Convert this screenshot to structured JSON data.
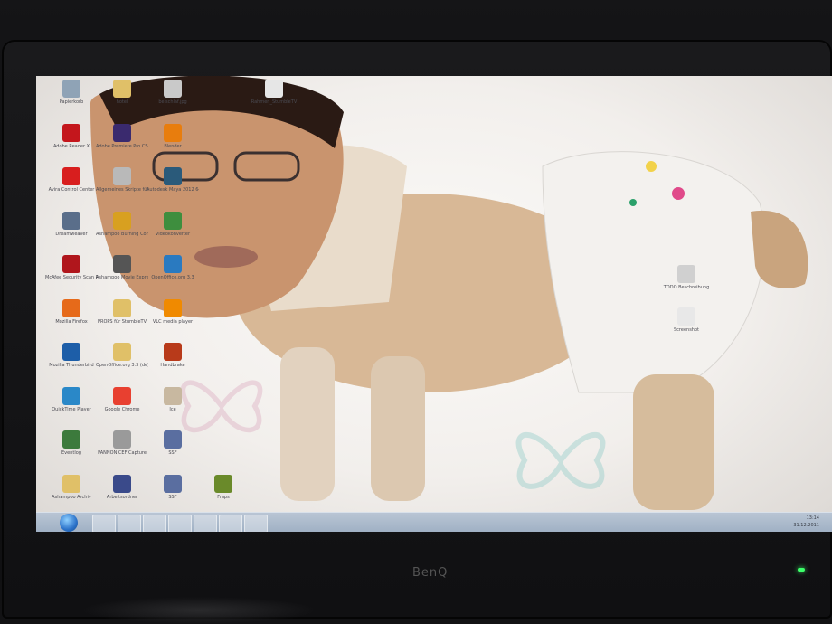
{
  "monitor": {
    "brand": "BenQ"
  },
  "desktop_icons": [
    {
      "label": "Papierkorb",
      "icon": "recycle-bin-icon",
      "color": "#8fa3b6"
    },
    {
      "label": "hotel",
      "icon": "folder-icon",
      "color": "#e0c068"
    },
    {
      "label": "beischlaf.jpg",
      "icon": "image-file-icon",
      "color": "#c9c9c9"
    },
    {
      "label": "Rahmen_StumbleTV",
      "icon": "image-file-icon",
      "color": "#e6e6e6"
    },
    {
      "label": "Adobe Reader X",
      "icon": "adobe-reader-icon",
      "color": "#c4161c"
    },
    {
      "label": "Adobe Premiere Pro CS4",
      "icon": "premiere-icon",
      "color": "#3a2a6e"
    },
    {
      "label": "Blender",
      "icon": "blender-icon",
      "color": "#e87d0d"
    },
    {
      "label": "Avira Control Center",
      "icon": "avira-icon",
      "color": "#d81e1e"
    },
    {
      "label": "Allgemeines Skripte für Studenten ...",
      "icon": "document-icon",
      "color": "#b9b9b9"
    },
    {
      "label": "Autodesk Maya 2012 64 bit",
      "icon": "maya-icon",
      "color": "#2a5a7a"
    },
    {
      "label": "Dreamweaver",
      "icon": "checklist-icon",
      "color": "#5a6e8a"
    },
    {
      "label": "Ashampoo Burning Control Panel",
      "icon": "control-panel-icon",
      "color": "#d8a020"
    },
    {
      "label": "Videokonverter",
      "icon": "video-converter-icon",
      "color": "#3e8e3e"
    },
    {
      "label": "McAfee Security Scan Plus",
      "icon": "mcafee-icon",
      "color": "#b0161c"
    },
    {
      "label": "Ashampoo Movie Express",
      "icon": "film-reel-icon",
      "color": "#555555"
    },
    {
      "label": "OpenOffice.org 3.3",
      "icon": "openoffice-icon",
      "color": "#2a7ac0"
    },
    {
      "label": "Mozilla Firefox",
      "icon": "firefox-icon",
      "color": "#e66a1a"
    },
    {
      "label": "PROPS für StumbleTV",
      "icon": "folder-icon",
      "color": "#e0c068"
    },
    {
      "label": "VLC media player",
      "icon": "vlc-icon",
      "color": "#f08a00"
    },
    {
      "label": "Mozilla Thunderbird",
      "icon": "thunderbird-icon",
      "color": "#1d5ea8"
    },
    {
      "label": "OpenOffice.org 3.3 (de) Installation Files",
      "icon": "folder-icon",
      "color": "#e0c068"
    },
    {
      "label": "Handbrake",
      "icon": "handbrake-icon",
      "color": "#b83a1a"
    },
    {
      "label": "QuickTime Player",
      "icon": "quicktime-icon",
      "color": "#2a88c8"
    },
    {
      "label": "Google Chrome",
      "icon": "chrome-icon",
      "color": "#e84030"
    },
    {
      "label": "Ice",
      "icon": "dog-image-icon",
      "color": "#c8b8a0"
    },
    {
      "label": "Eventlog",
      "icon": "image-icon",
      "color": "#3c7a3c"
    },
    {
      "label": "PANNON CEF Capture",
      "icon": "cap-icon",
      "color": "#9a9a9a"
    },
    {
      "label": "SSF",
      "icon": "pdf-file-icon",
      "color": "#5a6ea0"
    },
    {
      "label": "Ashampoo Archiv",
      "icon": "folder-icon",
      "color": "#e0c068"
    },
    {
      "label": "Arbeitsordner",
      "icon": "film-strip-icon",
      "color": "#3a4a8a"
    },
    {
      "label": "SSF",
      "icon": "pdf-file-icon",
      "color": "#5a6ea0"
    },
    {
      "label": "Fraps",
      "icon": "fraps-icon",
      "color": "#6a8a2a"
    },
    {
      "label": "TODO Beschreibung",
      "icon": "document-icon",
      "color": "#d0d0d0"
    },
    {
      "label": "Screenshot",
      "icon": "document-icon",
      "color": "#e8e8e8"
    }
  ],
  "taskbar": {
    "apps": [
      "explorer-icon",
      "media-player-icon",
      "chrome-icon",
      "firefox-icon",
      "premiere-icon",
      "thunderbird-icon",
      "recorder-icon"
    ],
    "clock": "13:14",
    "date": "31.12.2011"
  }
}
